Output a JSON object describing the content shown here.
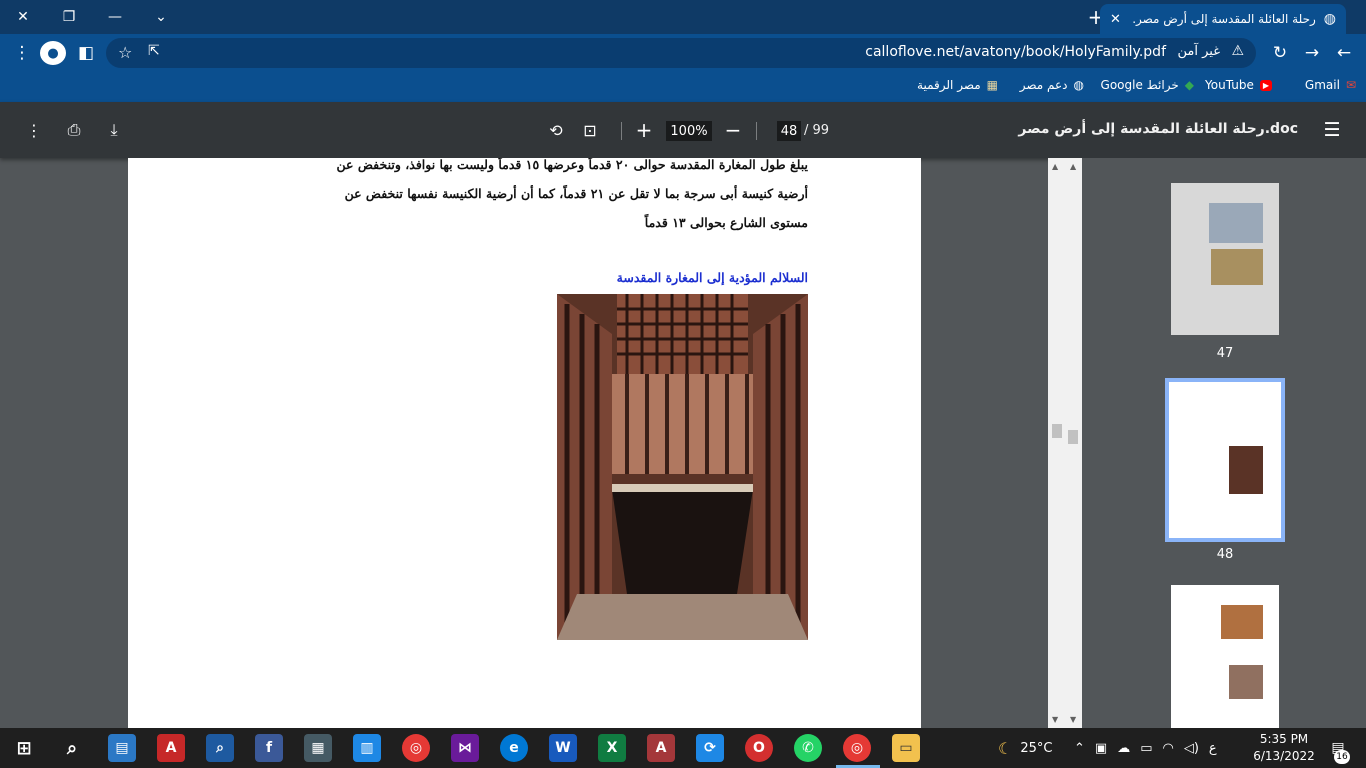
{
  "browser": {
    "tab_title": "رحلة العائلة المقدسة إلى أرض مصر.",
    "security_label": "غير آمن",
    "url": "calloflove.net/avatony/book/HolyFamily.pdf",
    "bookmarks": [
      {
        "label": "Gmail",
        "icon": "gmail-icon"
      },
      {
        "label": "YouTube",
        "icon": "youtube-icon"
      },
      {
        "label": "خرائط Google",
        "icon": "maps-icon"
      },
      {
        "label": "دعم مصر",
        "icon": "globe-icon"
      },
      {
        "label": "مصر الرقمية",
        "icon": "digital-egypt-icon"
      }
    ]
  },
  "pdf_toolbar": {
    "doc_title": "رحلة العائلة المقدسة إلى أرض مصر.doc",
    "current_page": "48",
    "total_pages": "/ 99",
    "zoom": "100%"
  },
  "document": {
    "paragraph_lines": [
      "يبلغ طول المغارة المقدسة حوالى ٢٠ قدماً وعرضها ١٥ قدماً وليست بها نوافذ، وتنخفض عن",
      "أرضية كنيسة أبى سرجة بما لا تقل عن ٢١ قدماً، كما أن أرضية الكنيسة نفسها تنخفض عن",
      "مستوى الشارع بحوالى ١٣ قدماً"
    ],
    "caption": "السلالم المؤدية إلى المغارة المقدسة"
  },
  "thumbnails": [
    {
      "page": "47"
    },
    {
      "page": "48"
    }
  ],
  "taskbar": {
    "temperature": "25°C",
    "time": "5:35 PM",
    "date": "6/13/2022",
    "language": "ع",
    "notification_count": "16"
  },
  "colors": {
    "titlebar": "#0f3a66",
    "toolbar": "#0b4f8f",
    "pdf_toolbar": "#323639",
    "caption_blue": "#1c2fd0"
  }
}
